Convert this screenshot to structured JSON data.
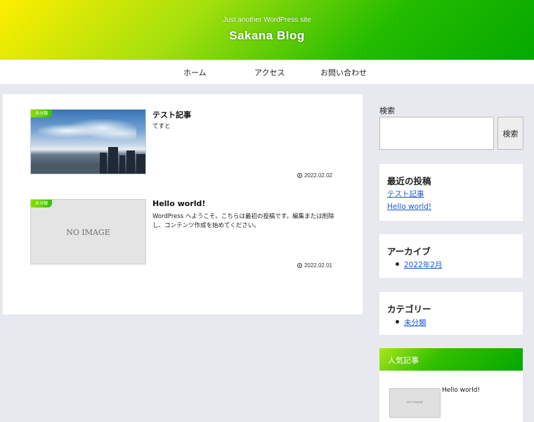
{
  "header": {
    "tagline": "Just another WordPress site",
    "site_title": "Sakana Blog"
  },
  "nav": {
    "items": [
      {
        "label": "ホーム"
      },
      {
        "label": "アクセス"
      },
      {
        "label": "お問い合わせ"
      }
    ]
  },
  "posts": [
    {
      "category": "未分類",
      "title": "テスト記事",
      "excerpt": "てすと",
      "date": "2022.02.02",
      "thumbnail": "photo"
    },
    {
      "category": "未分類",
      "title": "Hello world!",
      "excerpt": "WordPress へようこそ。こちらは最初の投稿です。編集または削除し、コンテンツ作成を始めてください。",
      "date": "2022.02.01",
      "thumbnail": "no-image",
      "thumbnail_text": "NO IMAGE"
    }
  ],
  "sidebar": {
    "search": {
      "label": "検索",
      "button": "検索",
      "value": ""
    },
    "recent": {
      "title": "最近の投稿",
      "items": [
        "テスト記事",
        "Hello world!"
      ]
    },
    "archive": {
      "title": "アーカイブ",
      "items": [
        "2022年2月"
      ]
    },
    "categories": {
      "title": "カテゴリー",
      "items": [
        "未分類"
      ]
    },
    "popular": {
      "title": "人気記事",
      "items": [
        {
          "title": "Hello world!",
          "thumbnail_text": "NO IMAGE"
        }
      ]
    }
  },
  "colors": {
    "link": "#1a56d6",
    "accent_green": "#22bb00",
    "accent_yellow": "#ffee00"
  }
}
